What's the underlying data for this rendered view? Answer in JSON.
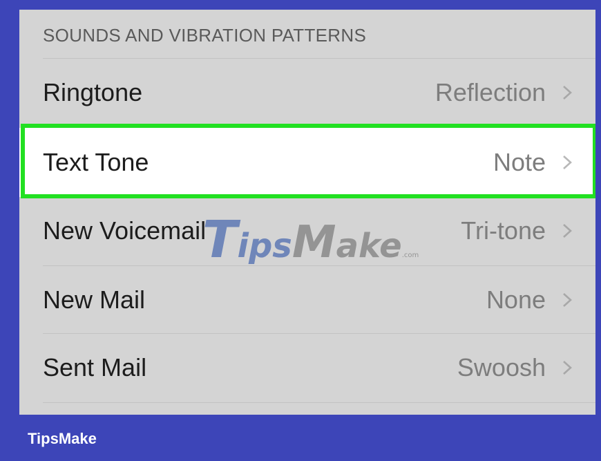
{
  "section_header": "SOUNDS AND VIBRATION PATTERNS",
  "rows": [
    {
      "label": "Ringtone",
      "value": "Reflection"
    },
    {
      "label": "Text Tone",
      "value": "Note"
    },
    {
      "label": "New Voicemail",
      "value": "Tri-tone"
    },
    {
      "label": "New Mail",
      "value": "None"
    },
    {
      "label": "Sent Mail",
      "value": "Swoosh"
    }
  ],
  "watermark": {
    "t": "T",
    "ips": "ips",
    "m": "M",
    "ake": "ake",
    "com": ".com"
  },
  "footer_brand": "TipsMake",
  "colors": {
    "frame_background": "#3d45b8",
    "list_background": "#d4d4d4",
    "highlight_border": "#22e022",
    "highlight_background": "#ffffff"
  },
  "icons": {
    "row_disclosure": "chevron-right-icon"
  }
}
